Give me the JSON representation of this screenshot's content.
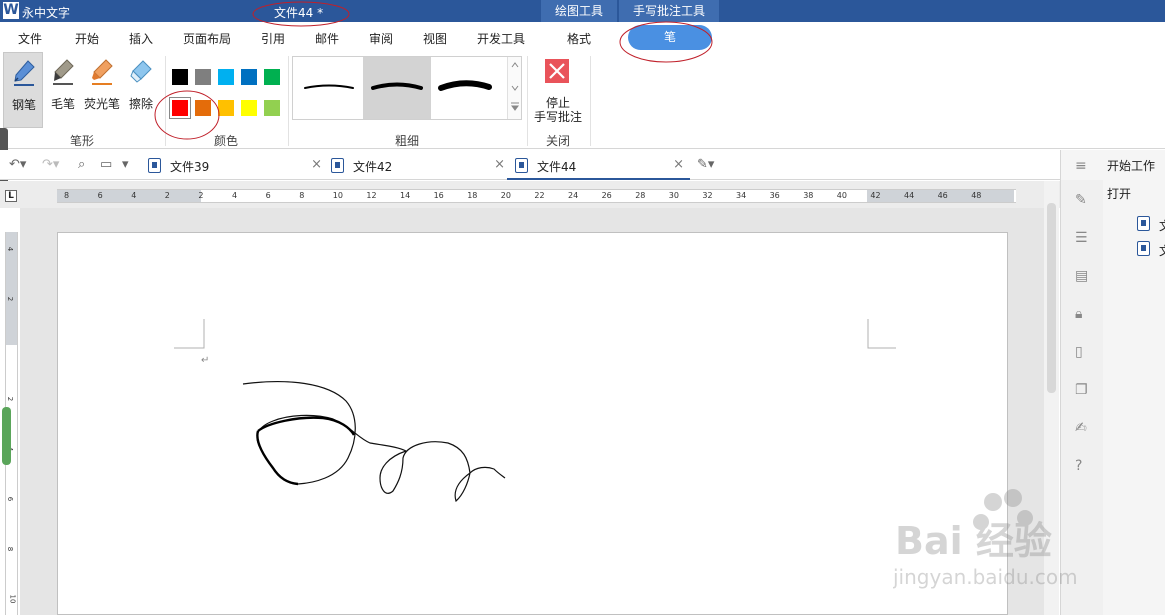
{
  "titlebar": {
    "app_name": "永中文字",
    "doc_title": "文件44 *",
    "context_tabs": [
      "绘图工具",
      "手写批注工具"
    ]
  },
  "menu": {
    "items": [
      "文件",
      "开始",
      "插入",
      "页面布局",
      "引用",
      "邮件",
      "审阅",
      "视图",
      "开发工具",
      "格式"
    ],
    "active_tab": "笔"
  },
  "ribbon": {
    "pen_group": {
      "label": "笔形",
      "tools": [
        {
          "name": "钢笔",
          "icon": "fountain-pen-icon",
          "active": true
        },
        {
          "name": "毛笔",
          "icon": "brush-pen-icon",
          "active": false
        },
        {
          "name": "荧光笔",
          "icon": "highlighter-icon",
          "active": false
        },
        {
          "name": "擦除",
          "icon": "eraser-icon",
          "active": false
        }
      ]
    },
    "color_group": {
      "label": "颜色",
      "colors": [
        "#000000",
        "#7f7f7f",
        "#00b0f0",
        "#0070c0",
        "#00b050",
        "#ff0000",
        "#e46c0a",
        "#ffc000",
        "#ffff00",
        "#92d050"
      ],
      "selected": "#ff0000"
    },
    "thickness_group": {
      "label": "粗细",
      "selected_index": 1
    },
    "close_group": {
      "label": "关闭",
      "stop_label_line1": "停止",
      "stop_label_line2": "手写批注",
      "icon": "stop-x-icon"
    }
  },
  "doc_tabs": [
    {
      "label": "文件39",
      "active": false
    },
    {
      "label": "文件42",
      "active": false
    },
    {
      "label": "文件44",
      "active": true
    }
  ],
  "ruler": {
    "h_labels": [
      "8",
      "6",
      "4",
      "2",
      "2",
      "4",
      "6",
      "8",
      "10",
      "12",
      "14",
      "16",
      "18",
      "20",
      "22",
      "24",
      "26",
      "28",
      "30",
      "32",
      "34",
      "36",
      "38",
      "40",
      "42",
      "44",
      "46",
      "48"
    ],
    "v_labels": [
      "4",
      "2",
      "2",
      "4",
      "6",
      "8",
      "10"
    ],
    "corner": "L"
  },
  "right_pane": {
    "title": "开始工作",
    "open_label": "打开",
    "files": [
      "文",
      "文"
    ]
  },
  "watermark": {
    "text": "Bai 经验",
    "sub": "jingyan.baidu.com"
  }
}
